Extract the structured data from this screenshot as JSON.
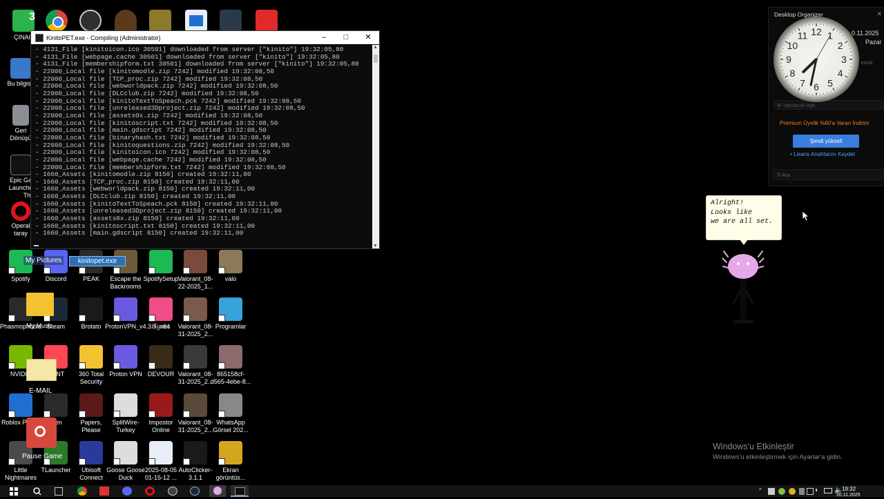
{
  "top_icons": {
    "badge_three": "3",
    "partial_label": "ÇINAI"
  },
  "left_column": [
    {
      "name": "computer",
      "label": "Bu bilgisa"
    },
    {
      "name": "recycle-bin",
      "label": "Geri Dönüşü"
    },
    {
      "name": "epic-games",
      "label": "Epic Ga Launche",
      "extra": "Thi"
    },
    {
      "name": "opera",
      "label": "Operal taray"
    }
  ],
  "console": {
    "title": "KinitoPET.exe - Compiling (Administrator)",
    "lines": [
      "- 4131_File [kinitoicon.ico 30501] downloaded from server [\"kinito\"] 19:32:05,80",
      "- 4131_File [webpage.cache 30501] downloaded from server [\"kinito\"] 19:32:05,80",
      "- 4131_File [membershipform.txt 30501] downloaded from server [\"kinito\"] 19:32:05,80",
      "- 22000_Local file [kinitomodle.zip 7242] modified 19:32:08,50",
      "- 22000_Local file [TCP_proc.zip 7242] modified 19:32:08,50",
      "- 22000_Local file [webworldpack.zip 7242] modified 19:32:08,50",
      "- 22000_Local file [DLCclub.zip 7242] modified 19:32:08,50",
      "- 22000_Local file [kinitoTextToSpeach.pck 7242] modified 19:32:08,50",
      "- 22000_Local file [unreleased3Dproject.zip 7242] modified 19:32:08,50",
      "- 22000_Local file [assets0x.zip 7242] modified 19:32:08,50",
      "- 22000_Local file [kinitoscript.txt 7242] modified 19:32:08,50",
      "- 22000_Local file [main.gdscript 7242] modified 19:32:08,50",
      "- 22000_Local file [binaryhash.txt 7242] modified 19:32:08,50",
      "- 22000_Local file [kinitoquestions.zip 7242] modified 19:32:08,50",
      "- 22000_Local file [kinitoicon.ico 7242] modified 19:32:08,50",
      "- 22000_Local file [webpage.cache 7242] modified 19:32:08,50",
      "- 22000_Local file [membershipform.txt 7242] modified 19:32:08,50",
      "- 1660_Assets [kinitomodle.zip 8150] created 19:32:11,00",
      "- 1660_Assets [TCP_proc.zip 8150] created 19:32:11,00",
      "- 1660_Assets [webworldpack.zip 8150] created 19:32:11,00",
      "- 1660_Assets [DLCclub.zip 8150] created 19:32:11,00",
      "- 1660_Assets [kinitoTextToSpeach.pck 8150] created 19:32:11,00",
      "- 1660_Assets [unreleased3Dproject.zip 8150] created 19:32:11,00",
      "- 1660_Assets [assets0x.zip 8150] created 19:32:11,00",
      "- 1660_Assets [kinitoscript.txt 8150] created 19:32:11,00",
      "- 1660_Assets [main.gdscript 8150] created 19:32:11,00"
    ]
  },
  "kinito_overlays": {
    "my_pictures": "My Pictures",
    "kinitopet_exe": "kinitopet.exe",
    "my_music": "My Music",
    "email": "E-MAIL",
    "pause_game": "Pause Game"
  },
  "desktop_icons": [
    {
      "id": "spotify",
      "label": "Spotify"
    },
    {
      "id": "discord",
      "label": "Discord"
    },
    {
      "id": "peak",
      "label": "PEAK"
    },
    {
      "id": "escape-backrooms",
      "label": "Escape the Backrooms"
    },
    {
      "id": "spotifysetup",
      "label": "SpotifySetup"
    },
    {
      "id": "valorant-1",
      "label": "Valorant_08-22-2025_1..."
    },
    {
      "id": "valo",
      "label": "valo"
    },
    {
      "id": "phasmophobia",
      "label": "Phasmophobia"
    },
    {
      "id": "steam",
      "label": "Steam"
    },
    {
      "id": "brotato",
      "label": "Brotato"
    },
    {
      "id": "protonvpn-setup",
      "label": "ProtonVPN_v4.3.5_x64"
    },
    {
      "id": "itunes",
      "label": "iTunes"
    },
    {
      "id": "valorant-2",
      "label": "Valorant_08-31-2025_2..."
    },
    {
      "id": "programlar",
      "label": "Programlar"
    },
    {
      "id": "nvidia",
      "label": "NVIDIA"
    },
    {
      "id": "valorant-game",
      "label": "RANT"
    },
    {
      "id": "360-total-security",
      "label": "360 Total Security"
    },
    {
      "id": "proton-vpn",
      "label": "Proton VPN"
    },
    {
      "id": "devour",
      "label": "DEVOUR"
    },
    {
      "id": "valorant-3",
      "label": "Valorant_08-31-2025_2..."
    },
    {
      "id": "image-file",
      "label": "865158cf-d565-4ebe-8..."
    },
    {
      "id": "roblox",
      "label": "Roblox Player"
    },
    {
      "id": "bmen",
      "label": "Men"
    },
    {
      "id": "papers-please",
      "label": "Papers, Please"
    },
    {
      "id": "splitwire",
      "label": "SplitWire-Turkey"
    },
    {
      "id": "impostor-online",
      "label": "Impostor Online"
    },
    {
      "id": "valorant-4",
      "label": "Valorant_08-31-2025_2..."
    },
    {
      "id": "whatsapp-image",
      "label": "WhatsApp Görsel 202..."
    },
    {
      "id": "little-nightmares",
      "label": "Little Nightmares"
    },
    {
      "id": "tlauncher",
      "label": "TLauncher"
    },
    {
      "id": "ubisoft-connect",
      "label": "Ubisoft Connect"
    },
    {
      "id": "goose",
      "label": "Goose Goose Duck"
    },
    {
      "id": "video-file",
      "label": "2025-08-05 01-15-12 ..."
    },
    {
      "id": "autoclicker",
      "label": "AutoClicker-3.1.1"
    },
    {
      "id": "screenshot",
      "label": "Ekran görüntüs..."
    }
  ],
  "organizer": {
    "title": "Desktop Organizer",
    "date": "0.11.2025",
    "weekday": "Pazar",
    "side_text": "ezinti",
    "todo": "Yapılacak öge",
    "promo": "Premium Üyelik %60'a Varan İndirim",
    "upgrade_button": "Şimdi yükselt",
    "license_link": "• Lisans Anahtarını Kaydet",
    "search_placeholder": "Ara"
  },
  "clock": {
    "hour": 7,
    "minute": 32,
    "second": 5
  },
  "kinito": {
    "speech": [
      "Alright!",
      "Looks like",
      "we are all set."
    ]
  },
  "activation": {
    "title": "Windows'u Etkinleştir",
    "subtitle": "Windows'u etkinleştirmek için Ayarlar'a gidin."
  },
  "taskbar": {
    "time": "19:32",
    "date": "20.11.2025"
  },
  "colors": {
    "promo": "#e87d2a",
    "upgrade_button": "#3b7ddd",
    "license_link": "#4aa3f0",
    "kinito_body": "#e6a8e8"
  }
}
